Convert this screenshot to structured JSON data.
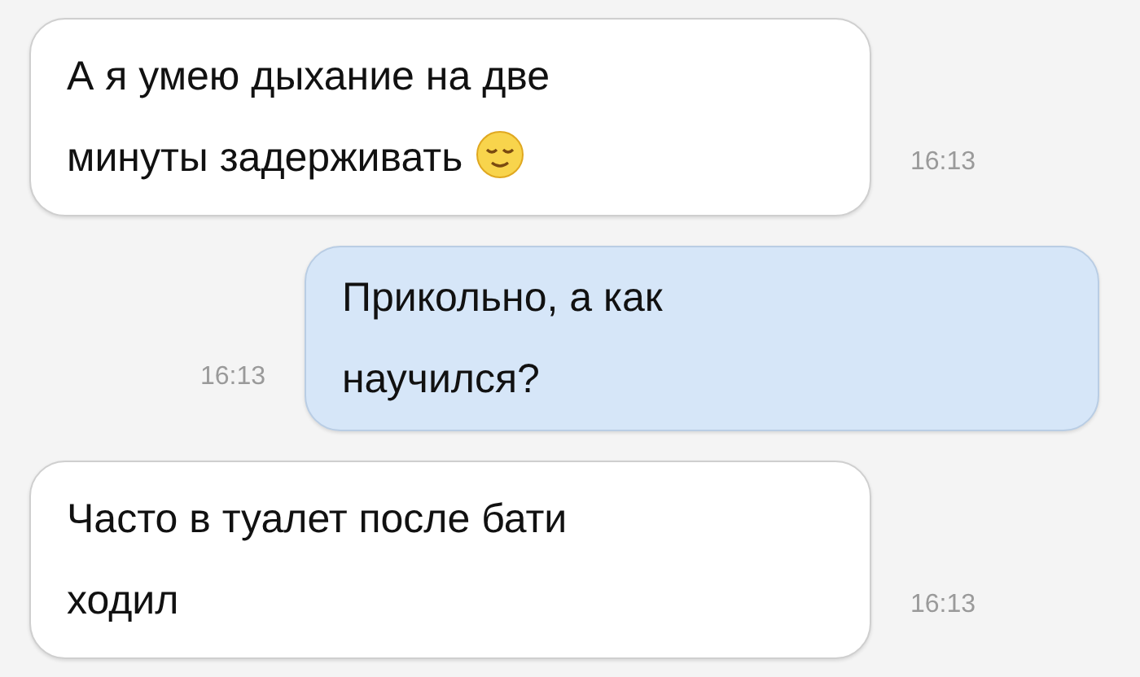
{
  "messages": [
    {
      "kind": "incoming",
      "lines": [
        "А я умею дыхание на две",
        "минуты задерживать"
      ],
      "emoji": true,
      "time": "16:13"
    },
    {
      "kind": "outgoing",
      "lines": [
        "Прикольно, а как",
        "научился?"
      ],
      "emoji": false,
      "time": "16:13"
    },
    {
      "kind": "incoming",
      "lines": [
        "Часто в туалет после бати",
        "ходил"
      ],
      "emoji": false,
      "time": "16:13"
    }
  ]
}
